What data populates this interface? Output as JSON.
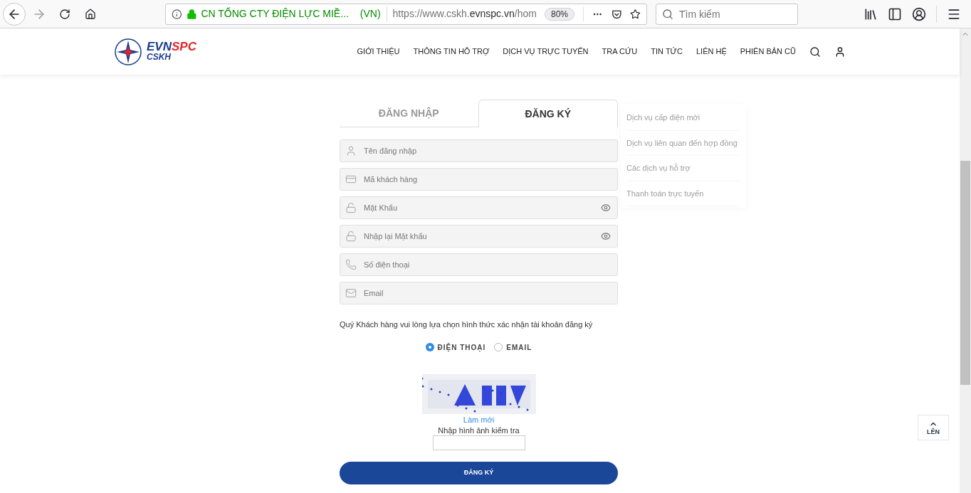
{
  "browser": {
    "site_identity": "CN TỔNG CTY ĐIỆN LỰC MIỀ...",
    "country": "(VN)",
    "url_host_prefix": "https://www.cskh.",
    "url_domain": "evnspc.vn",
    "url_path": "/hom",
    "zoom": "80%",
    "search": {
      "placeholder": "Tìm kiếm"
    }
  },
  "header": {
    "logo": {
      "primary": "EVN",
      "accent": "SPC",
      "sub": "CSKH"
    },
    "nav": [
      "GIỚI THIỆU",
      "THÔNG TIN HỖ TRỢ",
      "DỊCH VỤ TRỰC TUYẾN",
      "TRA CỨU",
      "TIN TỨC",
      "LIÊN HỆ",
      "PHIÊN BẢN CŨ"
    ]
  },
  "dropdown": {
    "items": [
      "Dịch vụ cấp điện mới",
      "Dịch vụ liên quan đến hợp đồng",
      "Các dịch vụ hỗ trợ",
      "Thanh toán trực tuyến"
    ]
  },
  "tabs": [
    {
      "label": "ĐĂNG NHẬP",
      "selected": false
    },
    {
      "label": "ĐĂNG KÝ",
      "selected": true
    }
  ],
  "fields": [
    {
      "kind": "user",
      "placeholder": "Tên đăng nhập",
      "password": false
    },
    {
      "kind": "card",
      "placeholder": "Mã khách hàng",
      "password": false
    },
    {
      "kind": "lock",
      "placeholder": "Mật Khẩu",
      "password": true
    },
    {
      "kind": "lock",
      "placeholder": "Nhập lại Mật khẩu",
      "password": true
    },
    {
      "kind": "phone",
      "placeholder": "Số điện thoại",
      "password": false
    },
    {
      "kind": "mail",
      "placeholder": "Email",
      "password": false
    }
  ],
  "prompt": "Quý Khách hàng vui lòng lựa chọn hình thức xác nhận tài khoản đăng ký",
  "radios": [
    {
      "label": "ĐIỆN THOẠI",
      "selected": true
    },
    {
      "label": "EMAIL",
      "selected": false
    }
  ],
  "captcha": {
    "kind": "picture",
    "refresh_link": "Làm mới",
    "label": "Nhập hình ảnh kiểm tra"
  },
  "submit": "ĐĂNG KÝ",
  "back_to_top": "LÊN"
}
